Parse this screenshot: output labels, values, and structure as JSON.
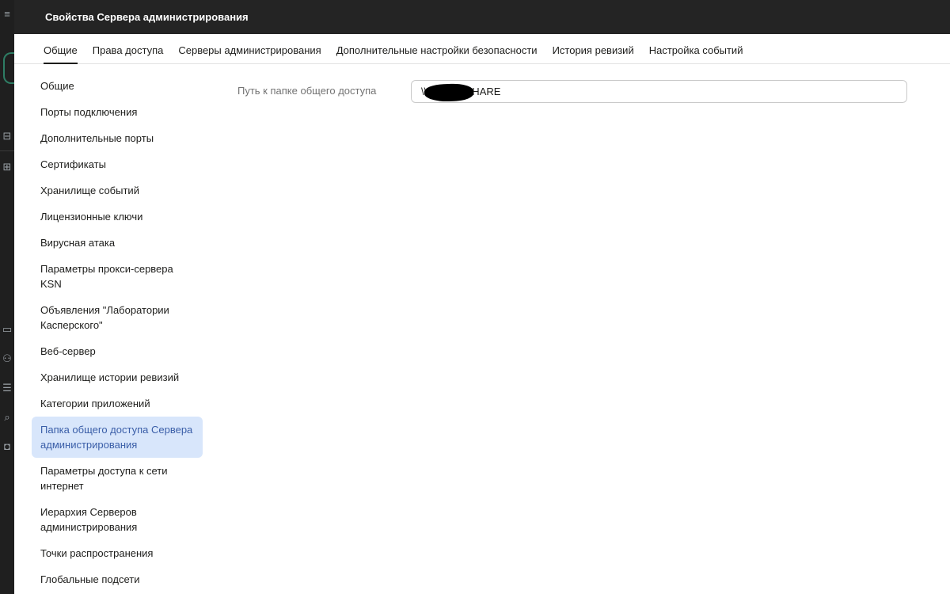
{
  "window": {
    "title": "Свойства Сервера администрирования"
  },
  "tabs": [
    {
      "label": "Общие",
      "active": true
    },
    {
      "label": "Права доступа",
      "active": false
    },
    {
      "label": "Серверы администрирования",
      "active": false
    },
    {
      "label": "Дополнительные настройки безопасности",
      "active": false
    },
    {
      "label": "История ревизий",
      "active": false
    },
    {
      "label": "Настройка событий",
      "active": false
    }
  ],
  "sidenav": {
    "items": [
      {
        "label": "Общие"
      },
      {
        "label": "Порты подключения"
      },
      {
        "label": "Дополнительные порты"
      },
      {
        "label": "Сертификаты"
      },
      {
        "label": "Хранилище событий"
      },
      {
        "label": "Лицензионные ключи"
      },
      {
        "label": "Вирусная атака"
      },
      {
        "label": "Параметры прокси-сервера KSN"
      },
      {
        "label": "Объявления \"Лаборатории Касперского\""
      },
      {
        "label": "Веб-сервер"
      },
      {
        "label": "Хранилище истории ревизий"
      },
      {
        "label": "Категории приложений"
      },
      {
        "label": "Папка общего доступа Сервера администрирования"
      },
      {
        "label": "Параметры доступа к сети интернет"
      },
      {
        "label": "Иерархия Серверов администрирования"
      },
      {
        "label": "Точки распространения"
      },
      {
        "label": "Глобальные подсети"
      }
    ],
    "active_index": 12
  },
  "share_folder": {
    "label": "Путь к папке общего доступа",
    "value": "\\\\         KLSHARE"
  },
  "colors": {
    "titlebar_bg": "#242424",
    "active_nav_bg": "#d8e6fb",
    "active_nav_text": "#3a5ea8"
  },
  "rail_icons": [
    "menu-icon",
    "network-icon",
    "apps-icon",
    "monitor-icon",
    "users-icon",
    "storage-icon",
    "search-icon",
    "lock-icon"
  ]
}
